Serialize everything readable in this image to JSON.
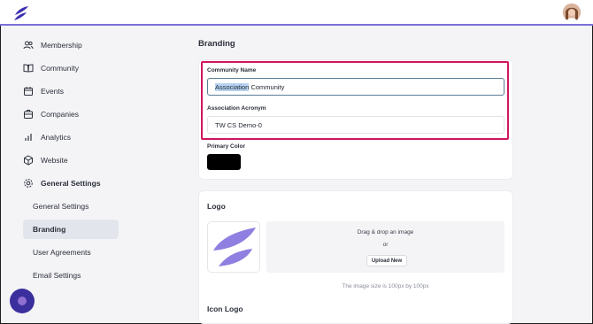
{
  "colors": {
    "accent": "#7b6fd8",
    "highlight": "#d0165f",
    "primary_color_value": "#000000"
  },
  "topbar": {
    "logo_icon": "leaf-logo-icon",
    "avatar_icon": "user-avatar"
  },
  "sidebar": {
    "items": [
      {
        "label": "Membership",
        "icon": "people-icon"
      },
      {
        "label": "Community",
        "icon": "book-icon"
      },
      {
        "label": "Events",
        "icon": "calendar-icon"
      },
      {
        "label": "Companies",
        "icon": "building-icon"
      },
      {
        "label": "Analytics",
        "icon": "bar-chart-icon"
      },
      {
        "label": "Website",
        "icon": "cube-icon"
      },
      {
        "label": "General Settings",
        "icon": "gear-icon"
      }
    ],
    "subitems": [
      {
        "label": "General Settings"
      },
      {
        "label": "Branding"
      },
      {
        "label": "User Agreements"
      },
      {
        "label": "Email Settings"
      }
    ],
    "active_subitem": "Branding"
  },
  "main": {
    "title": "Branding",
    "community_name": {
      "label": "Community Name",
      "value_selected": "Association",
      "value_rest": " Community"
    },
    "acronym": {
      "label": "Association Acronym",
      "value": "TW CS Demo-0"
    },
    "primary_color": {
      "label": "Primary Color"
    },
    "logo_card": {
      "title": "Logo",
      "drop_text": "Drag & drop an image",
      "or_text": "or",
      "upload_label": "Upload New",
      "hint": "The image size is 100px by 100px",
      "icon_logo_title": "Icon Logo"
    }
  }
}
